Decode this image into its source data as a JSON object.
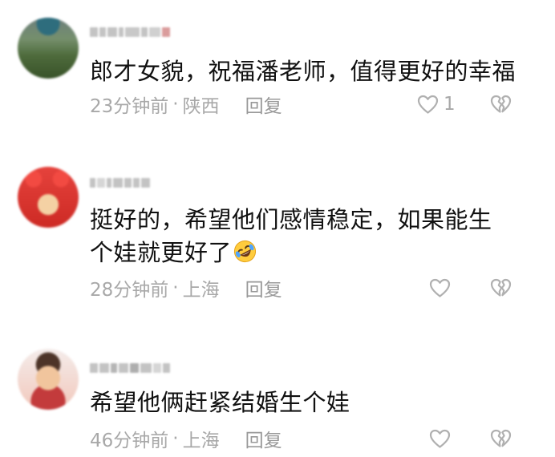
{
  "comments": [
    {
      "text": "郎才女貌，祝福潘老师，值得更好的幸福",
      "time": "23分钟前",
      "location": "陕西",
      "reply_label": "回复",
      "likes": "1"
    },
    {
      "text": "挺好的，希望他们感情稳定，如果能生个娃就更好了",
      "time": "28分钟前",
      "location": "上海",
      "reply_label": "回复",
      "likes": "",
      "emoji": "rolling-on-floor-laughing-emoji"
    },
    {
      "text": "希望他俩赶紧结婚生个娃",
      "time": "46分钟前",
      "location": "上海",
      "reply_label": "回复",
      "likes": ""
    }
  ],
  "meta_separator": "·",
  "icons": {
    "like": "heart-outline-icon",
    "dislike": "broken-heart-icon"
  },
  "colors": {
    "text": "#111111",
    "meta": "#a8a8a8",
    "icon": "#b0b0b0"
  }
}
